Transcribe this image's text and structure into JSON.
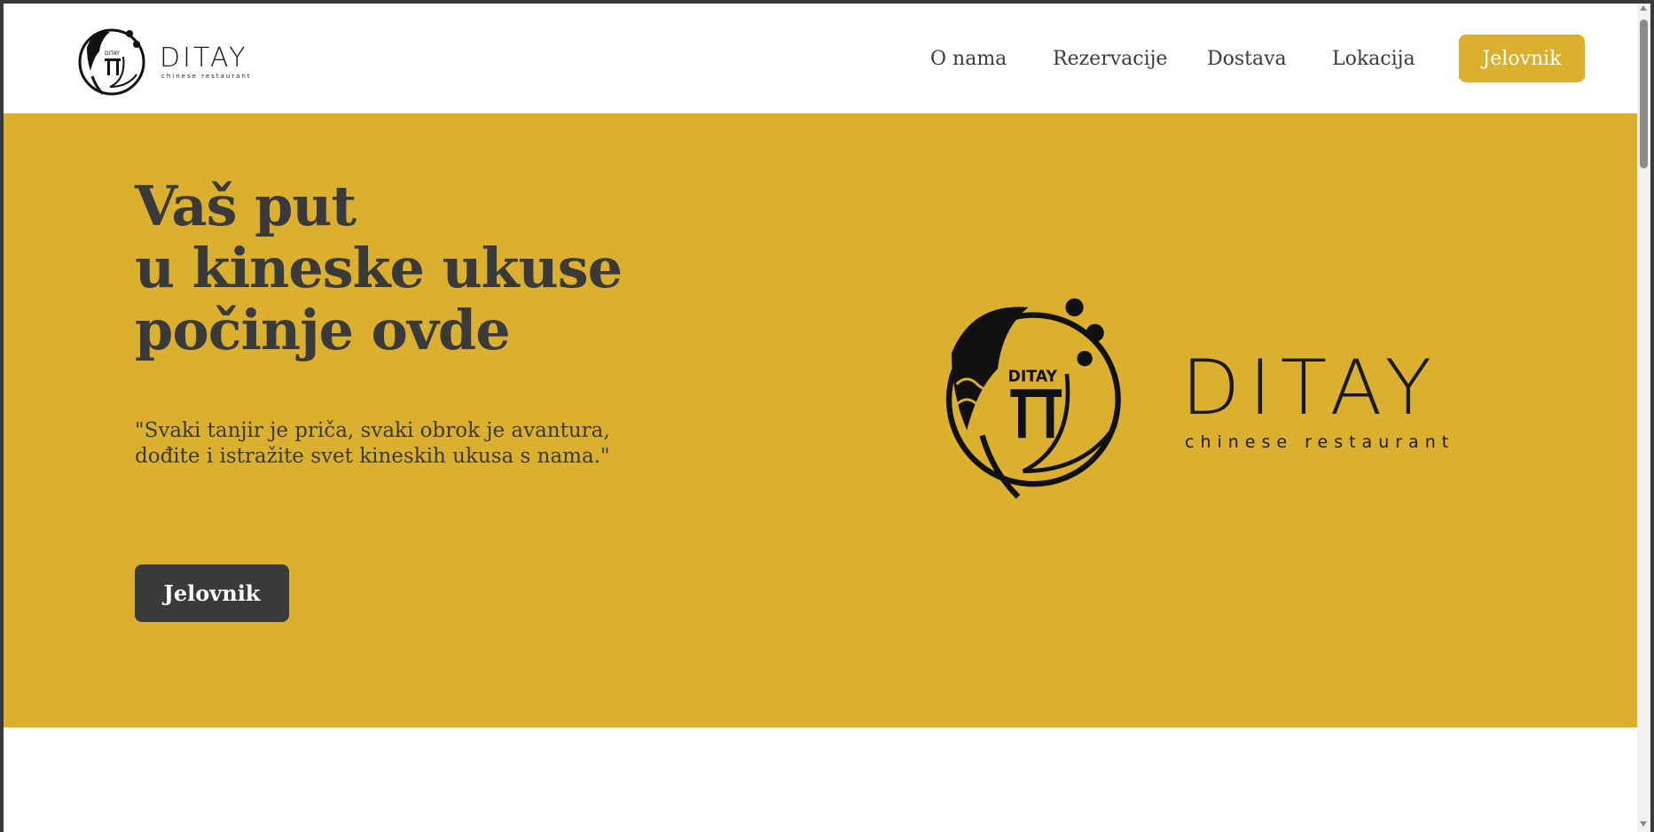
{
  "header": {
    "logo": {
      "brand": "DITAY",
      "tagline": "chinese restaurant",
      "emblem_text": "DITAY"
    },
    "nav": [
      {
        "label": "O nama"
      },
      {
        "label": "Rezervacije"
      },
      {
        "label": "Dostava"
      },
      {
        "label": "Lokacija"
      }
    ],
    "cta_label": "Jelovnik"
  },
  "hero": {
    "title_lines": [
      "Vaš put",
      "u kineske ukuse",
      "počinje ovde"
    ],
    "quote_lines": [
      "\"Svaki tanjir je priča, svaki obrok je avantura,",
      "dođite i istražite svet kineskih ukusa s nama.\""
    ],
    "button_label": "Jelovnik",
    "logo": {
      "brand": "DITAY",
      "tagline": "chinese restaurant",
      "emblem_text": "DITAY"
    }
  },
  "colors": {
    "accent": "#dab02e",
    "dark": "#3a3a3a",
    "white": "#ffffff"
  },
  "icons": {
    "logo_emblem": "geisha-torii-emblem-icon"
  }
}
